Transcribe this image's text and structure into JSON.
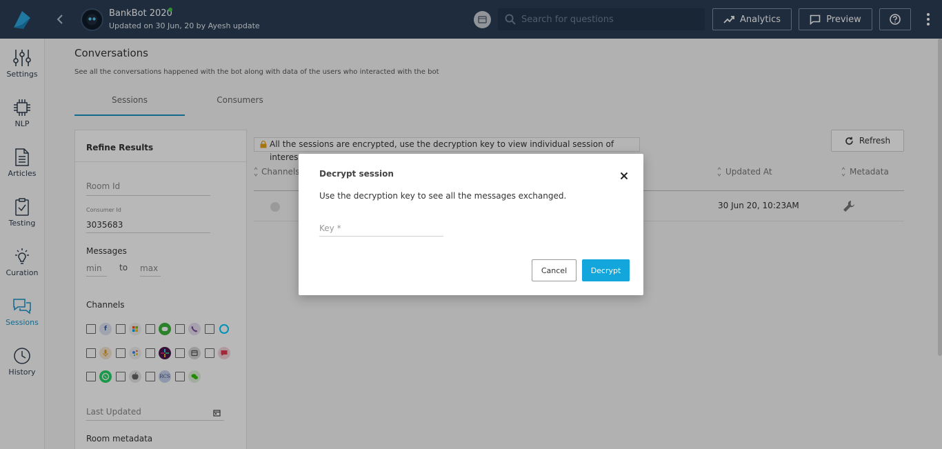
{
  "header": {
    "bot_name": "BankBot 2020",
    "bot_subtitle": "Updated on 30 Jun, 20 by Ayesh update",
    "search_placeholder": "Search for questions",
    "analytics_label": "Analytics",
    "preview_label": "Preview"
  },
  "nav": {
    "items": [
      {
        "label": "Settings",
        "icon": "settings-sliders-icon"
      },
      {
        "label": "NLP",
        "icon": "chip-icon"
      },
      {
        "label": "Articles",
        "icon": "document-icon"
      },
      {
        "label": "Testing",
        "icon": "clipboard-check-icon"
      },
      {
        "label": "Curation",
        "icon": "lightbulb-icon"
      },
      {
        "label": "Sessions",
        "icon": "chat-bubbles-icon"
      },
      {
        "label": "History",
        "icon": "clock-icon"
      }
    ],
    "active": "Sessions"
  },
  "page": {
    "title": "Conversations",
    "subtitle": "See all the conversations happened with the bot along with data of the users who interacted with the bot",
    "tabs": [
      "Sessions",
      "Consumers"
    ],
    "active_tab": "Sessions"
  },
  "filters": {
    "title": "Refine Results",
    "room_id_placeholder": "Room Id",
    "consumer_id_label": "Consumer Id",
    "consumer_id_value": "3035683",
    "messages_label": "Messages",
    "min_placeholder": "min",
    "to_label": "to",
    "max_placeholder": "max",
    "channels_label": "Channels",
    "last_updated_placeholder": "Last Updated",
    "room_metadata_label": "Room metadata",
    "rcs_label": "RCS"
  },
  "sessions": {
    "notice": "All the sessions are encrypted, use the decryption key to view individual session of interest",
    "refresh_label": "Refresh",
    "columns": [
      "Channels",
      "Updated At",
      "Metadata"
    ],
    "rows": [
      {
        "updated_at": "30 Jun 20, 10:23AM"
      }
    ]
  },
  "modal": {
    "title": "Decrypt session",
    "description": "Use the decryption key to see all the messages exchanged.",
    "key_placeholder": "Key *",
    "cancel_label": "Cancel",
    "decrypt_label": "Decrypt"
  },
  "colors": {
    "topbar": "#2b3e55",
    "accent": "#1a93c4",
    "decrypt_button": "#12a6dd"
  }
}
